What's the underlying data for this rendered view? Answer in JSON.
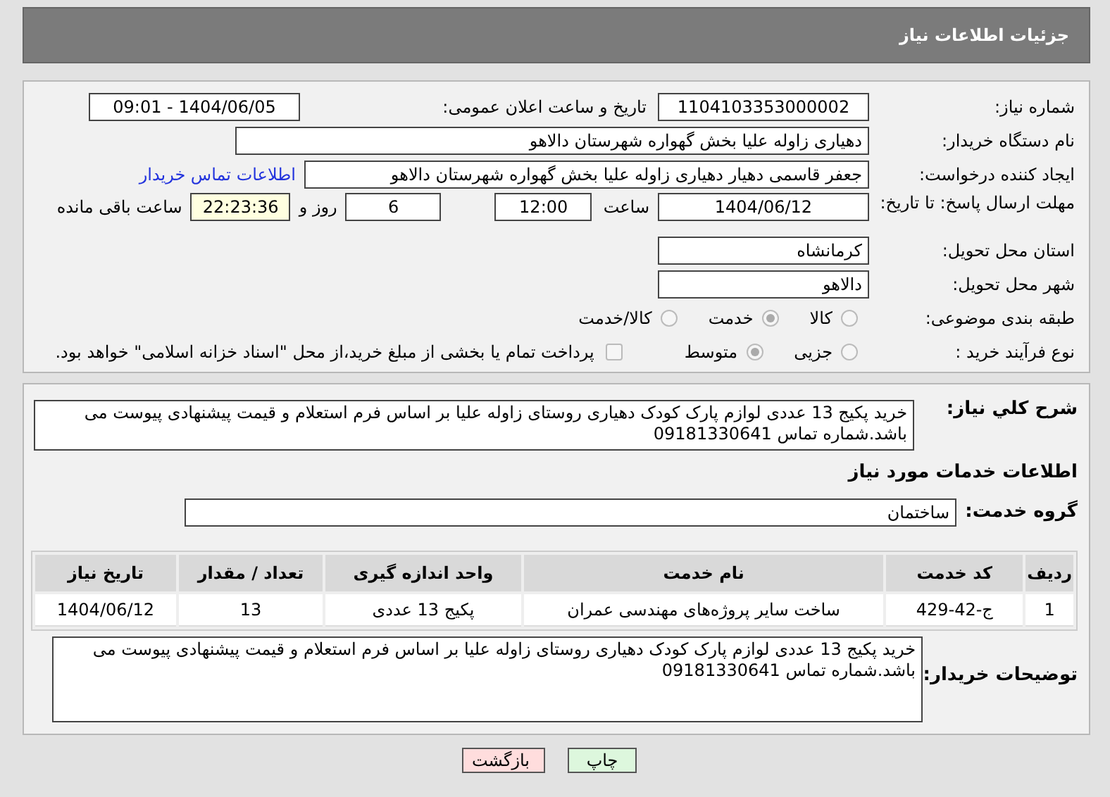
{
  "header": {
    "title": "جزئیات اطلاعات نیاز"
  },
  "need_number": {
    "label": "شماره نیاز:",
    "value": "1104103353000002"
  },
  "announce": {
    "label": "تاریخ و ساعت اعلان عمومی:",
    "value": "1404/06/05 - 09:01"
  },
  "buyer_org": {
    "label": "نام دستگاه خریدار:",
    "value": "دهیاری زاوله علیا بخش گهواره شهرستان دالاهو"
  },
  "creator": {
    "label": "ایجاد کننده درخواست:",
    "value": "جعفر قاسمی دهیار دهیاری زاوله علیا بخش گهواره شهرستان دالاهو",
    "link": "اطلاعات تماس خریدار"
  },
  "deadline": {
    "label": "مهلت ارسال پاسخ: تا تاریخ:",
    "date": "1404/06/12",
    "time_label": "ساعت",
    "time": "12:00",
    "days": "6",
    "days_label": "روز و",
    "remaining": "22:23:36",
    "remaining_label": "ساعت باقی مانده"
  },
  "province": {
    "label": "استان محل تحویل:",
    "value": "کرمانشاه"
  },
  "city": {
    "label": "شهر محل تحویل:",
    "value": "دالاهو"
  },
  "category": {
    "label": "طبقه بندی موضوعی:",
    "options": [
      {
        "label": "کالا",
        "selected": false
      },
      {
        "label": "خدمت",
        "selected": true
      },
      {
        "label": "کالا/خدمت",
        "selected": false
      }
    ]
  },
  "process": {
    "label": "نوع فرآیند خرید :",
    "options": [
      {
        "label": "جزیی",
        "selected": false
      },
      {
        "label": "متوسط",
        "selected": true
      }
    ],
    "payment": {
      "label": "پرداخت تمام یا بخشی از مبلغ خرید،از محل \"اسناد خزانه اسلامی\" خواهد بود.",
      "checked": false
    }
  },
  "description": {
    "label": "شرح کلي نياز:",
    "value": "خرید پکیج 13 عددی لوازم پارک کودک دهیاری روستای زاوله علیا بر اساس فرم استعلام و قیمت پیشنهادی پیوست می باشد.شماره تماس 09181330641"
  },
  "services_title": "اطلاعات خدمات مورد نیاز",
  "service_group": {
    "label": "گروه خدمت:",
    "value": "ساختمان"
  },
  "table": {
    "columns": [
      "ردیف",
      "کد خدمت",
      "نام خدمت",
      "واحد اندازه گیری",
      "تعداد / مقدار",
      "تاریخ نیاز"
    ],
    "rows": [
      [
        "1",
        "ج-42-429",
        "ساخت سایر پروژه‌های مهندسی عمران",
        "پکیج 13 عددی",
        "13",
        "1404/06/12"
      ]
    ]
  },
  "buyer_notes": {
    "label": "توضیحات خریدار:",
    "value": "خرید پکیج 13 عددی لوازم پارک کودک دهیاری روستای زاوله علیا بر اساس فرم استعلام و قیمت پیشنهادی پیوست می باشد.شماره تماس 09181330641"
  },
  "buttons": [
    {
      "label": "چاپ",
      "kind": "print"
    },
    {
      "label": "بازگشت",
      "kind": "back"
    }
  ]
}
